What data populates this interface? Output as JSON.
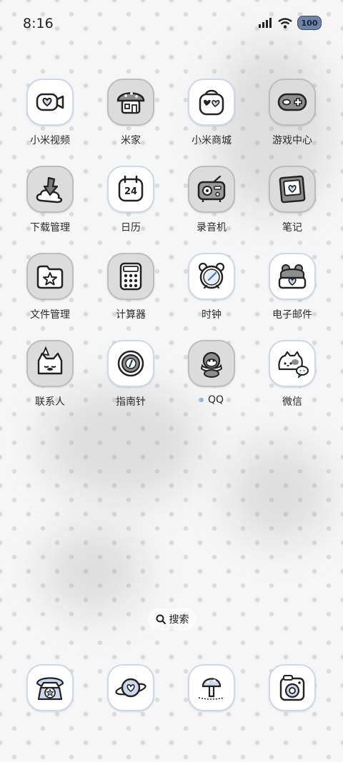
{
  "status": {
    "time": "8:16",
    "battery": "100"
  },
  "apps": [
    {
      "label": "小米视频",
      "icon": "video-camera-heart-icon"
    },
    {
      "label": "米家",
      "icon": "mushroom-house-icon"
    },
    {
      "label": "小米商城",
      "icon": "shopping-bag-icon"
    },
    {
      "label": "游戏中心",
      "icon": "gamepad-icon"
    },
    {
      "label": "下载管理",
      "icon": "download-cloud-icon"
    },
    {
      "label": "日历",
      "icon": "calendar-icon",
      "day": "24"
    },
    {
      "label": "录音机",
      "icon": "radio-recorder-icon"
    },
    {
      "label": "笔记",
      "icon": "notes-photo-icon"
    },
    {
      "label": "文件管理",
      "icon": "folder-star-icon"
    },
    {
      "label": "计算器",
      "icon": "calculator-icon"
    },
    {
      "label": "时钟",
      "icon": "alarm-clock-icon"
    },
    {
      "label": "电子邮件",
      "icon": "email-frog-icon"
    },
    {
      "label": "联系人",
      "icon": "contacts-cat-icon"
    },
    {
      "label": "指南针",
      "icon": "compass-icon"
    },
    {
      "label": "QQ",
      "icon": "qq-penguin-icon"
    },
    {
      "label": "微信",
      "icon": "wechat-cat-icon"
    }
  ],
  "search": {
    "label": "搜索"
  },
  "dock": [
    {
      "icon": "phone-icon"
    },
    {
      "icon": "planet-heart-icon"
    },
    {
      "icon": "mushroom-icon"
    },
    {
      "icon": "camera-icon"
    }
  ]
}
